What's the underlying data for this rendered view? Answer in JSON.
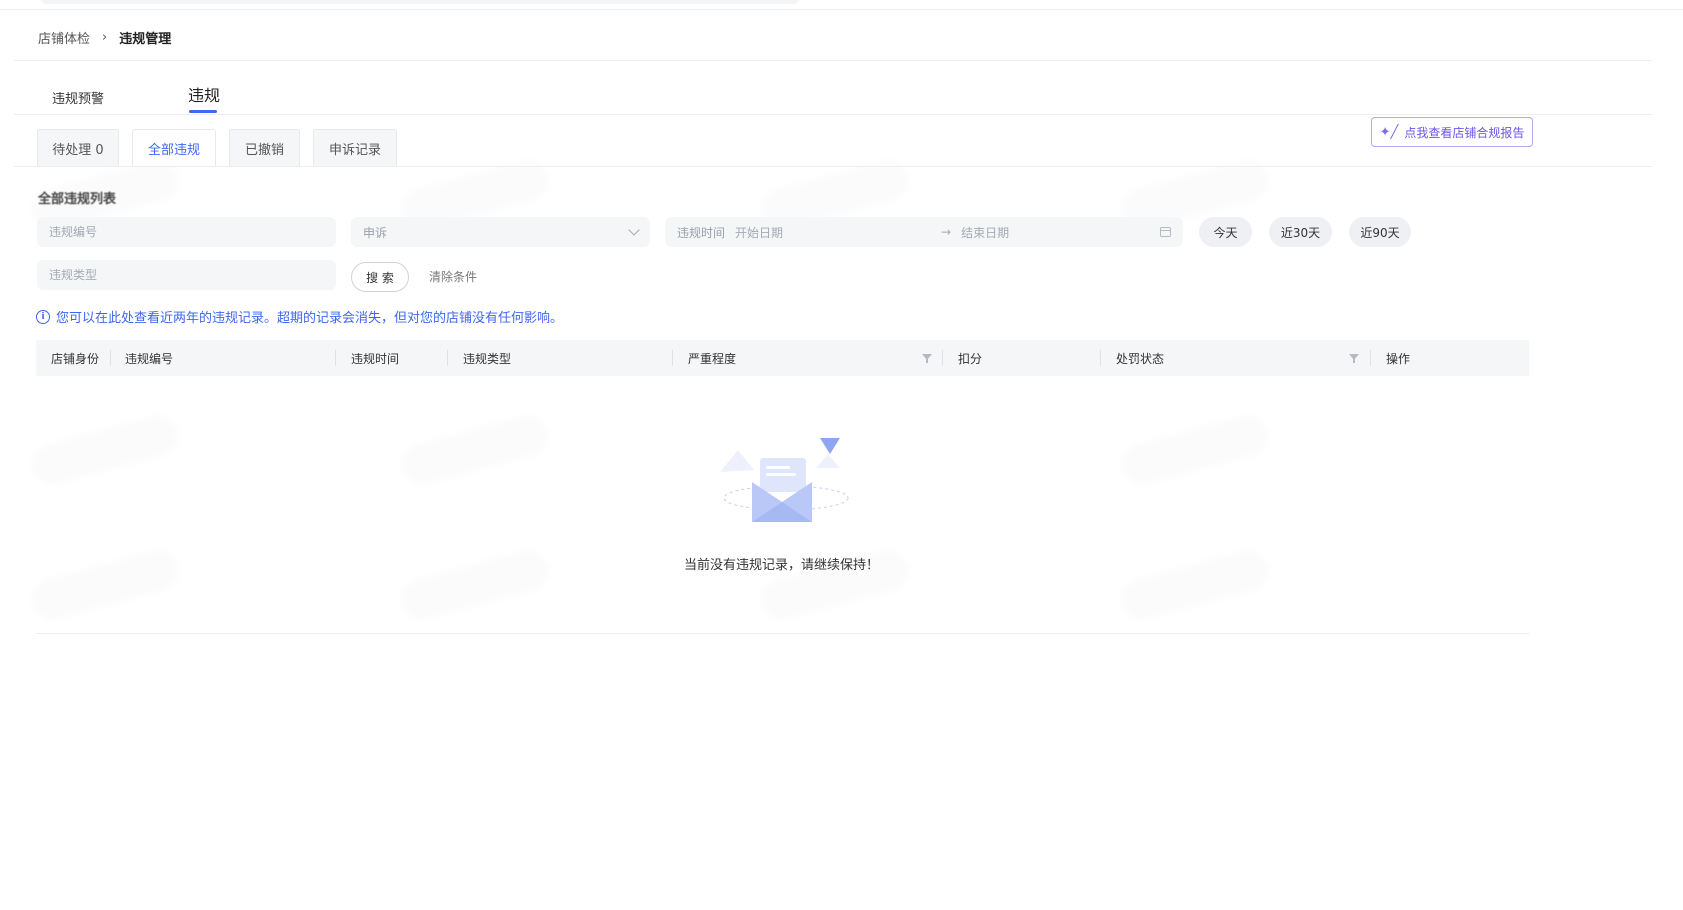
{
  "breadcrumb": {
    "parent": "店铺体检",
    "separator": "›",
    "current": "违规管理"
  },
  "main_tabs": [
    {
      "label": "违规预警"
    },
    {
      "label": "违规"
    }
  ],
  "report_button": {
    "label": "点我查看店铺合规报告",
    "icon": "sparkle-wand-icon"
  },
  "sub_tabs": [
    {
      "label": "待处理 0"
    },
    {
      "label": "全部违规"
    },
    {
      "label": "已撤销"
    },
    {
      "label": "申诉记录"
    }
  ],
  "section_title": "全部违规列表",
  "filters": {
    "violation_number_placeholder": "违规编号",
    "appeal_select_value": "申诉",
    "date_range": {
      "label": "违规时间",
      "start_placeholder": "开始日期",
      "arrow": "→",
      "end_placeholder": "结束日期"
    },
    "violation_type_placeholder": "违规类型",
    "quick_ranges": [
      "今天",
      "近30天",
      "近90天"
    ],
    "search_label": "搜 索",
    "clear_label": "清除条件"
  },
  "notice": {
    "icon": "info-icon",
    "icon_glyph": "i",
    "text": "您可以在此处查看近两年的违规记录。超期的记录会消失，但对您的店铺没有任何影响。"
  },
  "table": {
    "columns": [
      "店铺身份",
      "违规编号",
      "违规时间",
      "违规类型",
      "严重程度",
      "扣分",
      "处罚状态",
      "操作"
    ]
  },
  "empty_state": {
    "icon": "empty-mailbox-icon",
    "text": "当前没有违规记录，请继续保持！"
  },
  "colors": {
    "accent": "#3f66f2",
    "report_border": "#b7a8f5",
    "header_bg": "#f5f6f8"
  }
}
